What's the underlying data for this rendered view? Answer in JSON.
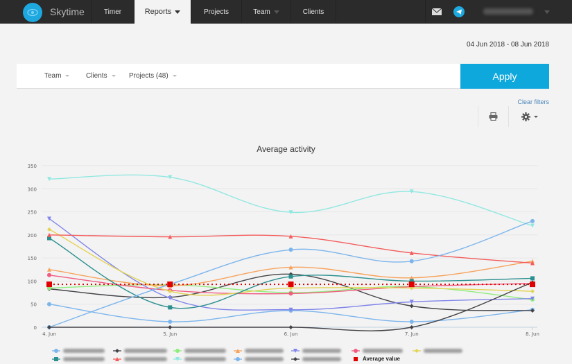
{
  "header": {
    "brand": "Skytime",
    "nav": [
      {
        "label": "Timer",
        "active": false
      },
      {
        "label": "Reports",
        "active": true
      },
      {
        "label": "Projects",
        "active": false
      },
      {
        "label": "Team",
        "active": false
      },
      {
        "label": "Clients",
        "active": false
      }
    ],
    "icons": [
      "mail-icon",
      "telegram-icon"
    ],
    "user_name": "[blurred user name]"
  },
  "date_range": "04 Jun 2018 - 08 Jun 2018",
  "filters": {
    "team_label": "Team",
    "clients_label": "Clients",
    "projects_label": "Projects (48)",
    "apply_label": "Apply",
    "clear_label": "Clear filters"
  },
  "toolbar": {
    "print_icon": "print-icon",
    "settings_icon": "gear-icon"
  },
  "chart_data": {
    "type": "line",
    "title": "Average activity",
    "xlabel": "",
    "ylabel": "",
    "categories": [
      "4. Jun",
      "5. Jun",
      "6. Jun",
      "7. Jun",
      "8. Jun"
    ],
    "ylim": [
      0,
      350
    ],
    "yticks": [
      0,
      50,
      100,
      150,
      200,
      250,
      300,
      350
    ],
    "grid": true,
    "legend_position": "bottom",
    "series": [
      {
        "name": "[blurred name 1]",
        "color": "#7cb5ec",
        "marker": "circle",
        "values": [
          50,
          12,
          36,
          12,
          38
        ]
      },
      {
        "name": "[blurred name 2]",
        "color": "#434348",
        "marker": "diamond",
        "values": [
          83,
          65,
          115,
          46,
          36
        ]
      },
      {
        "name": "[blurred name 3]",
        "color": "#90ed7d",
        "marker": "circle",
        "values": [
          85,
          92,
          75,
          88,
          60
        ]
      },
      {
        "name": "[blurred name 4]",
        "color": "#f7a35c",
        "marker": "triangle",
        "values": [
          125,
          90,
          130,
          107,
          143
        ]
      },
      {
        "name": "[blurred name 5]",
        "color": "#8085e9",
        "marker": "triangle-down",
        "values": [
          235,
          63,
          38,
          55,
          62
        ]
      },
      {
        "name": "[blurred name 6]",
        "color": "#f15c80",
        "marker": "circle",
        "values": [
          113,
          80,
          73,
          88,
          95
        ]
      },
      {
        "name": "[blurred name 7]",
        "color": "#e4d354",
        "marker": "diamond",
        "values": [
          212,
          78,
          85,
          85,
          78
        ]
      },
      {
        "name": "[blurred name 8]",
        "color": "#2b908f",
        "marker": "square",
        "values": [
          193,
          43,
          110,
          100,
          106
        ]
      },
      {
        "name": "[blurred name 9]",
        "color": "#f45b5b",
        "marker": "triangle",
        "values": [
          200,
          196,
          197,
          161,
          139
        ]
      },
      {
        "name": "[blurred name 10]",
        "color": "#91e8e1",
        "marker": "triangle-down",
        "values": [
          321,
          325,
          249,
          294,
          220
        ]
      },
      {
        "name": "[blurred name 11]",
        "color": "#7cb5ec",
        "marker": "circle",
        "values": [
          0,
          93,
          168,
          143,
          230
        ]
      },
      {
        "name": "[blurred name 12]",
        "color": "#434348",
        "marker": "diamond",
        "values": [
          0,
          0,
          0,
          0,
          97
        ]
      },
      {
        "name": "Average value",
        "color": "#e00000",
        "marker": "square",
        "dashed": true,
        "values": [
          93,
          93,
          93,
          93,
          93
        ]
      }
    ]
  }
}
